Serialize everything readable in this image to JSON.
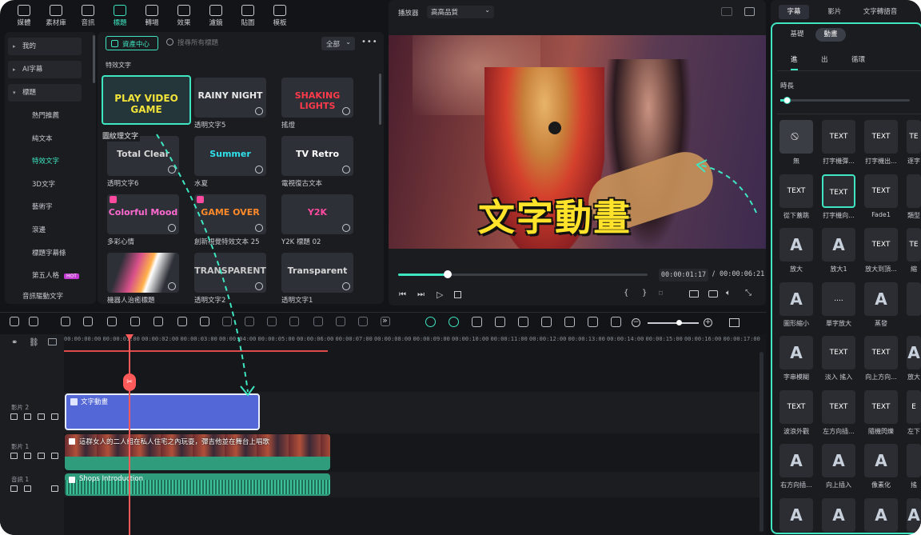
{
  "toolbar": {
    "tabs": [
      {
        "label": "媒體",
        "icon": "media-icon"
      },
      {
        "label": "素材庫",
        "icon": "stock-icon"
      },
      {
        "label": "音訊",
        "icon": "music-icon"
      },
      {
        "label": "標題",
        "icon": "title-icon"
      },
      {
        "label": "轉場",
        "icon": "transition-icon"
      },
      {
        "label": "效果",
        "icon": "effects-icon"
      },
      {
        "label": "濾鏡",
        "icon": "filter-icon"
      },
      {
        "label": "貼圖",
        "icon": "sticker-icon"
      },
      {
        "label": "模板",
        "icon": "template-icon"
      }
    ],
    "active_tab": "標題"
  },
  "sidebar": {
    "categories": [
      {
        "label": "我的"
      },
      {
        "label": "AI字幕"
      },
      {
        "label": "標題"
      }
    ],
    "items": [
      {
        "label": "熱門推薦"
      },
      {
        "label": "純文本"
      },
      {
        "label": "特效文字",
        "active": true
      },
      {
        "label": "3D文字"
      },
      {
        "label": "藝術字"
      },
      {
        "label": "滾邊"
      },
      {
        "label": "標題字幕條"
      },
      {
        "label": "第五人格",
        "badge": "HOT"
      }
    ],
    "footer_label": "音訊驅動文字"
  },
  "library": {
    "asset_center_label": "資產中心",
    "search_placeholder": "搜尋所有標題",
    "filter_label": "全部",
    "section_title": "特效文字",
    "tooltip": "圖紋理文字",
    "items": [
      {
        "preview": "PLAY VIDEO GAME",
        "caption": "",
        "color": "#f2e33a"
      },
      {
        "preview": "RAINY NIGHT",
        "caption": "透明文字5",
        "color": "#e8e8e8"
      },
      {
        "preview": "SHAKING LIGHTS",
        "caption": "搖燈",
        "color": "#ff3a4a"
      },
      {
        "preview": "Total Clear",
        "caption": "透明文字6",
        "color": "#d8d8d8"
      },
      {
        "preview": "Summer",
        "caption": "水夏",
        "color": "#2fe0ea"
      },
      {
        "preview": "TV Retro",
        "caption": "電視復古文本",
        "color": "#ffffff"
      },
      {
        "preview": "Colorful Mood",
        "caption": "多彩心情",
        "color": "#ff6ad0"
      },
      {
        "preview": "GAME OVER",
        "caption": "創新視覺特效文本 25",
        "color": "#ff8a2a"
      },
      {
        "preview": "Y2K",
        "caption": "Y2K 標題 02",
        "color": "#ff4aa0"
      },
      {
        "preview": "",
        "caption": "機器人治癒標題",
        "color": "#ff9a6a"
      },
      {
        "preview": "TRANSPARENT",
        "caption": "透明文字2",
        "color": "#c8c8c8"
      },
      {
        "preview": "Transparent",
        "caption": "透明文字1",
        "color": "#d8d8d8"
      }
    ]
  },
  "player": {
    "label": "播放器",
    "quality": "高高品質",
    "overlay_text": "文字動畫",
    "current_time": "00:00:01:17",
    "separator": "/",
    "total_time": "00:00:06:21",
    "progress": 0.2
  },
  "timeline": {
    "ruler": [
      "00:00:00:00",
      "00:00:01:00",
      "00:00:02:00",
      "00:00:03:00",
      "00:00:04:00",
      "00:00:05:00",
      "00:00:06:00",
      "00:00:07:00",
      "00:00:08:00",
      "00:00:09:00",
      "00:00:10:00",
      "00:00:11:00",
      "00:00:12:00",
      "00:00:13:00",
      "00:00:14:00",
      "00:00:15:00",
      "00:00:16:00",
      "00:00:17:00"
    ],
    "tracks": [
      {
        "label": "影片 2",
        "clip": "文字動畫"
      },
      {
        "label": "影片 1",
        "clip": "這群女人的二人組在私人住宅之內玩耍，彈吉他並在舞台上唱歌"
      },
      {
        "label": "音訊 1",
        "clip": "Shops Introduction"
      }
    ]
  },
  "right_panel": {
    "tabs": [
      "字幕",
      "影片",
      "文字轉語音"
    ],
    "active_tab": "字幕",
    "subtabs": [
      "基礎",
      "動畫"
    ],
    "active_subtab": "動畫",
    "anim_tabs": [
      "進",
      "出",
      "循環"
    ],
    "active_anim_tab": "進",
    "duration_label": "時長",
    "duration_fraction": 0.05,
    "presets": [
      {
        "label": "無",
        "glyph": "⃠"
      },
      {
        "label": "打字機彈...",
        "glyph": "TEXT"
      },
      {
        "label": "打字機出...",
        "glyph": "TEXT"
      },
      {
        "label": "逐字",
        "glyph": "TE"
      },
      {
        "label": "從下蓋跳",
        "glyph": "TEXT"
      },
      {
        "label": "打字機向...",
        "glyph": "TEXT"
      },
      {
        "label": "Fade1",
        "glyph": "TEXT"
      },
      {
        "label": "類型",
        "glyph": ""
      },
      {
        "label": "放大",
        "glyph": "A"
      },
      {
        "label": "放大1",
        "glyph": "A"
      },
      {
        "label": "放大到頂...",
        "glyph": "TEXT"
      },
      {
        "label": "縮",
        "glyph": "TE"
      },
      {
        "label": "圖形縮小",
        "glyph": "A"
      },
      {
        "label": "單字放大",
        "glyph": "...."
      },
      {
        "label": "蒸發",
        "glyph": "A"
      },
      {
        "label": "",
        "glyph": ""
      },
      {
        "label": "字串模糊",
        "glyph": "A"
      },
      {
        "label": "淡入 搖入",
        "glyph": "TEXT"
      },
      {
        "label": "向上方向...",
        "glyph": "TEXT"
      },
      {
        "label": "放大",
        "glyph": "A"
      },
      {
        "label": "波浪外觀",
        "glyph": "TEXT"
      },
      {
        "label": "左方向插...",
        "glyph": "TEXT"
      },
      {
        "label": "隨機閃爍",
        "glyph": "TEXT"
      },
      {
        "label": "左下",
        "glyph": "E"
      },
      {
        "label": "右方向插...",
        "glyph": "A"
      },
      {
        "label": "向上插入",
        "glyph": "A"
      },
      {
        "label": "像素化",
        "glyph": "A"
      },
      {
        "label": "搖",
        "glyph": ""
      },
      {
        "label": "",
        "glyph": "A"
      },
      {
        "label": "",
        "glyph": "A"
      },
      {
        "label": "",
        "glyph": "A"
      },
      {
        "label": "",
        "glyph": "A"
      }
    ]
  },
  "colors": {
    "accent": "#3ee6c1",
    "playhead": "#ff5a5a",
    "clip_title": "#5467d6",
    "clip_video": "#2f9c7c"
  }
}
